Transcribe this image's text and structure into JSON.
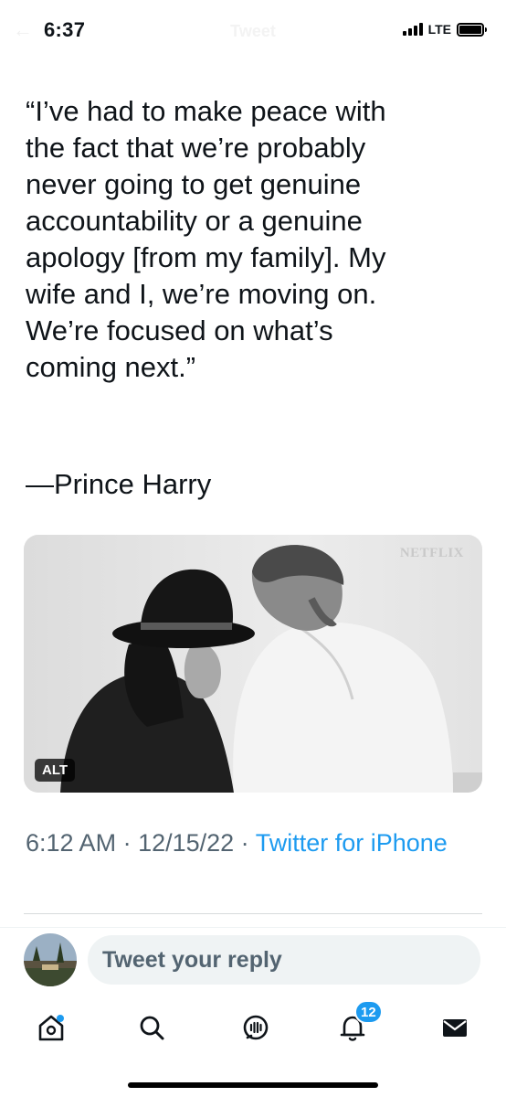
{
  "status_bar": {
    "time": "6:37",
    "network": "LTE",
    "header_title": "Tweet"
  },
  "tweet": {
    "quote": "“I’ve had to make peace with\nthe fact that we’re probably\nnever going to get genuine\naccountability or a genuine\napology [from my family]. My\nwife and I, we’re moving on.\nWe’re focused on what’s\ncoming next.”",
    "attribution": "—Prince Harry",
    "media": {
      "watermark": "NETFLIX",
      "alt_label": "ALT"
    },
    "time": "6:12 AM",
    "separator": " · ",
    "date": "12/15/22",
    "source": "Twitter for iPhone"
  },
  "reply": {
    "placeholder": "Tweet your reply"
  },
  "tabbar": {
    "notifications_count": "12",
    "icons": [
      "home-icon",
      "search-icon",
      "spaces-icon",
      "notifications-icon",
      "messages-icon"
    ]
  },
  "colors": {
    "accent": "#1d9bf0",
    "secondary_text": "#536471",
    "input_bg": "#eff3f4"
  }
}
